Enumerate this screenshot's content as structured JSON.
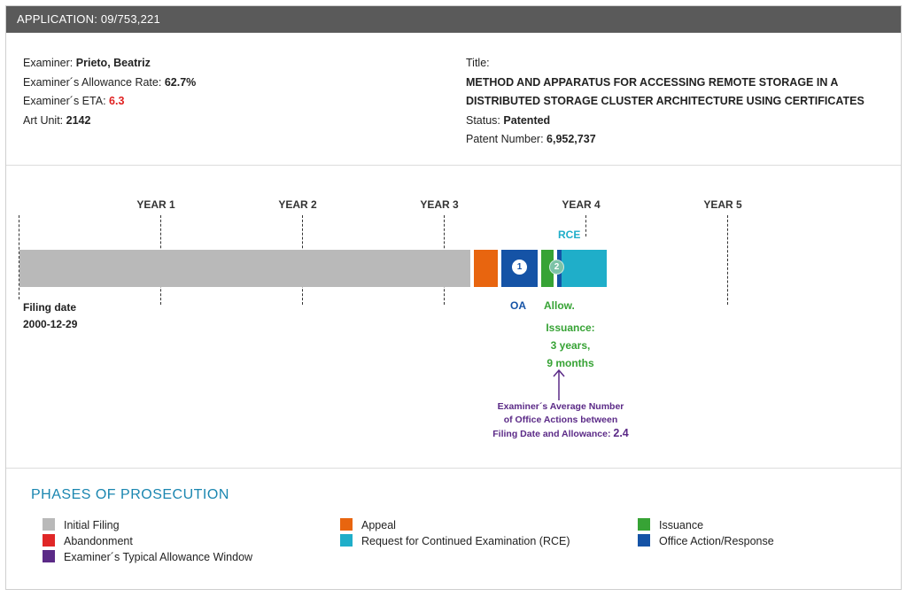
{
  "application": {
    "label": "APPLICATION: 09/753,221"
  },
  "examiner": {
    "name_label": "Examiner:",
    "name": "Prieto, Beatriz",
    "allowance_label": "Examiner´s Allowance Rate:",
    "allowance": "62.7%",
    "eta_label": "Examiner´s ETA:",
    "eta": "6.3",
    "art_unit_label": "Art Unit:",
    "art_unit": "2142"
  },
  "patent": {
    "title_label": "Title:",
    "title_line1": "METHOD AND APPARATUS FOR ACCESSING REMOTE STORAGE IN A",
    "title_line2": "DISTRIBUTED STORAGE CLUSTER ARCHITECTURE USING CERTIFICATES",
    "status_label": "Status:",
    "status": "Patented",
    "number_label": "Patent Number:",
    "number": "6,952,737"
  },
  "timeline": {
    "years": [
      "YEAR 1",
      "YEAR 2",
      "YEAR 3",
      "YEAR 4",
      "YEAR 5"
    ],
    "filing_label": "Filing date",
    "filing_date": "2000-12-29",
    "badge1": "1",
    "badge2": "2",
    "rce_label": "RCE",
    "oa_label": "OA",
    "allow_label": "Allow.",
    "issuance_line1": "Issuance:",
    "issuance_line2": "3 years,",
    "issuance_line3": "9 months",
    "avg_line1": "Examiner´s Average Number",
    "avg_line2": "of Office Actions between",
    "avg_line3": "Filing Date and Allowance:",
    "avg_value": "2.4"
  },
  "phases": {
    "title": "PHASES OF PROSECUTION",
    "items": [
      {
        "label": "Initial Filing",
        "color": "#b9b9b9"
      },
      {
        "label": "Abandonment",
        "color": "#e02727"
      },
      {
        "label": "Examiner´s Typical Allowance Window",
        "color": "#5b2a87"
      },
      {
        "label": "Appeal",
        "color": "#e8650f"
      },
      {
        "label": "Request for Continued Examination (RCE)",
        "color": "#1faec9"
      },
      {
        "label": "Issuance",
        "color": "#37a335"
      },
      {
        "label": "Office Action/Response",
        "color": "#1553a6"
      }
    ]
  }
}
